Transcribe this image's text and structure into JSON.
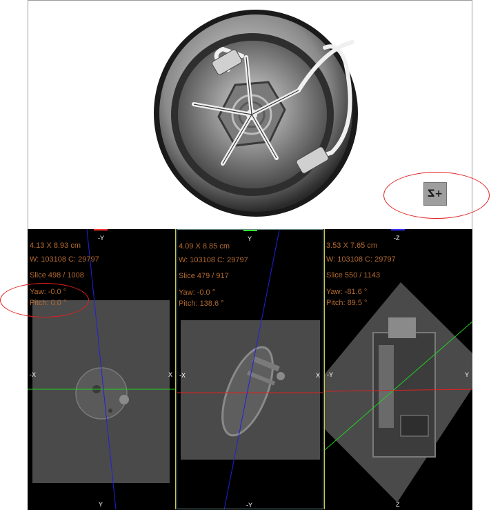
{
  "view3d": {
    "orientation_button": "+Z",
    "colors": {
      "annotation": "#e02020"
    }
  },
  "panels": [
    {
      "name": "axial",
      "dimensions": "4.13 X 8.93 cm",
      "window": "W: 103108 C: 29797",
      "slice": "Slice 498 / 1008",
      "yaw": "Yaw: -0.0 °",
      "pitch": "Pitch: 0.0 °",
      "label_top": "-Y",
      "label_bottom": "Y",
      "label_left": "-X",
      "label_right": "X",
      "indicator_color": "#ff3030"
    },
    {
      "name": "coronal",
      "dimensions": "4.09 X 8.85 cm",
      "window": "W: 103108 C: 29797",
      "slice": "Slice 479 / 917",
      "yaw": "Yaw: -0.0 °",
      "pitch": "Pitch: 138.6 °",
      "label_top": "Y",
      "label_bottom": "-Y",
      "label_left": "-X",
      "label_right": "X",
      "indicator_color": "#30ff30"
    },
    {
      "name": "sagittal",
      "dimensions": "3.53 X 7.65 cm",
      "window": "W: 103108 C: 29797",
      "slice": "Slice 550 / 1143",
      "yaw": "Yaw: -81.6 °",
      "pitch": "Pitch: 89.5 °",
      "label_top": "-Z",
      "label_bottom": "Z",
      "label_left": "-Y",
      "label_right": "Y",
      "indicator_color": "#3030ff"
    }
  ]
}
